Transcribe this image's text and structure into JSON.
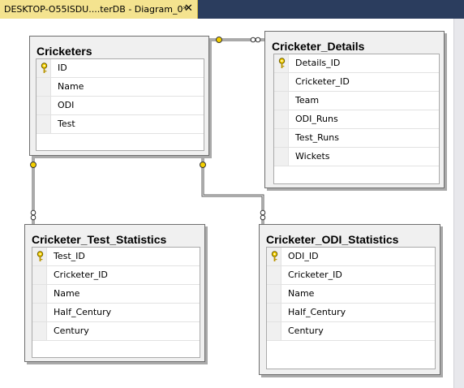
{
  "tab": {
    "title": "DESKTOP-O55ISDU....terDB - Diagram_0*",
    "close": "✕"
  },
  "tables": {
    "cricketers": {
      "title": "Cricketers",
      "columns": [
        "ID",
        "Name",
        "ODI",
        "Test"
      ]
    },
    "cricketer_details": {
      "title": "Cricketer_Details",
      "columns": [
        "Details_ID",
        "Cricketer_ID",
        "Team",
        "ODI_Runs",
        "Test_Runs",
        "Wickets"
      ]
    },
    "cricketer_test_statistics": {
      "title": "Cricketer_Test_Statistics",
      "columns": [
        "Test_ID",
        "Cricketer_ID",
        "Name",
        "Half_Century",
        "Century"
      ]
    },
    "cricketer_odi_statistics": {
      "title": "Cricketer_ODI_Statistics",
      "columns": [
        "ODI_ID",
        "Cricketer_ID",
        "Name",
        "Half_Century",
        "Century"
      ]
    }
  },
  "colors": {
    "tab_active": "#f4e38f",
    "tab_strip": "#2b3d5e",
    "key_icon": "#e6c200"
  }
}
